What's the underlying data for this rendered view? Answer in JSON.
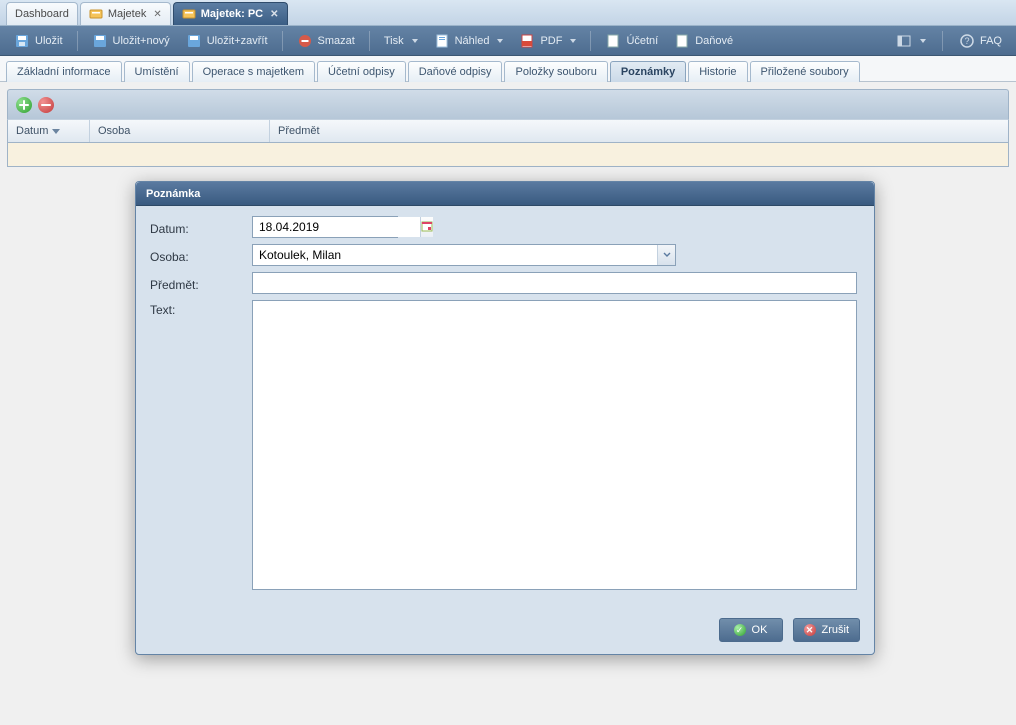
{
  "top_tabs": {
    "dashboard": "Dashboard",
    "majetek": "Majetek",
    "majetek_pc": "Majetek: PC"
  },
  "toolbar": {
    "save": "Uložit",
    "save_new": "Uložit+nový",
    "save_close": "Uložit+zavřít",
    "delete": "Smazat",
    "print": "Tisk",
    "preview": "Náhled",
    "pdf": "PDF",
    "accounting": "Účetní",
    "tax": "Daňové",
    "faq": "FAQ"
  },
  "subtabs": {
    "basic": "Základní informace",
    "location": "Umístění",
    "operations": "Operace s majetkem",
    "acc_depr": "Účetní odpisy",
    "tax_depr": "Daňové odpisy",
    "set_items": "Položky souboru",
    "notes": "Poznámky",
    "history": "Historie",
    "attachments": "Přiložené soubory"
  },
  "grid": {
    "col_date": "Datum",
    "col_person": "Osoba",
    "col_subject": "Předmět"
  },
  "dialog": {
    "title": "Poznámka",
    "label_date": "Datum:",
    "label_person": "Osoba:",
    "label_subject": "Předmět:",
    "label_text": "Text:",
    "value_date": "18.04.2019",
    "value_person": "Kotoulek, Milan",
    "value_subject": "",
    "value_text": "",
    "btn_ok": "OK",
    "btn_cancel": "Zrušit"
  }
}
